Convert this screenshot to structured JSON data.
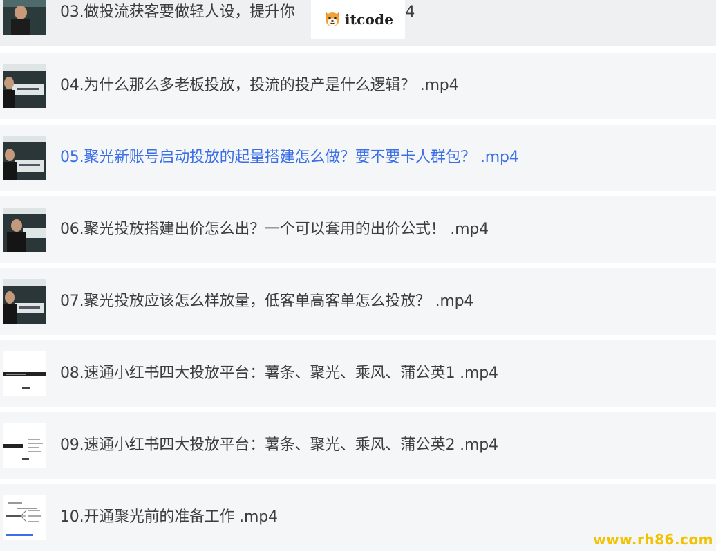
{
  "items": [
    {
      "label": "03.做投流获客要做轻人设，提升你",
      "tail": ".mp4",
      "thumb": "video"
    },
    {
      "label": "04.为什么那么多老板投放，投流的投产是什么逻辑？ .mp4",
      "thumb": "video"
    },
    {
      "label": "05.聚光新账号启动投放的起量搭建怎么做？要不要卡人群包？ .mp4",
      "thumb": "video",
      "active": true
    },
    {
      "label": "06.聚光投放搭建出价怎么出？一个可以套用的出价公式！ .mp4",
      "thumb": "video"
    },
    {
      "label": "07.聚光投放应该怎么样放量，低客单高客单怎么投放？ .mp4",
      "thumb": "video"
    },
    {
      "label": "08.速通小红书四大投放平台：薯条、聚光、乘风、蒲公英1 .mp4",
      "thumb": "slide"
    },
    {
      "label": "09.速通小红书四大投放平台：薯条、聚光、乘风、蒲公英2 .mp4",
      "thumb": "slide"
    },
    {
      "label": "10.开通聚光前的准备工作 .mp4",
      "thumb": "mindmap"
    }
  ],
  "badge": {
    "text": "itcode",
    "icon": "shiba-dog-icon"
  },
  "watermark": "www.rh86.com",
  "colors": {
    "row_bg": "#f5f6f7",
    "text": "#3d3d3d",
    "active_text": "#3b6fe8",
    "watermark": "#f2c200"
  }
}
